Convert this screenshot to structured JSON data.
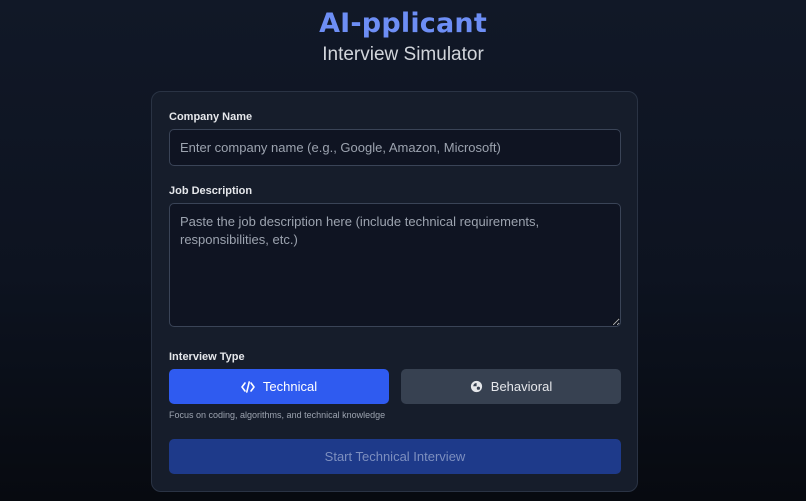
{
  "header": {
    "title": "AI-pplicant",
    "subtitle": "Interview Simulator"
  },
  "form": {
    "company": {
      "label": "Company Name",
      "placeholder": "Enter company name (e.g., Google, Amazon, Microsoft)",
      "value": ""
    },
    "job": {
      "label": "Job Description",
      "placeholder": "Paste the job description here (include technical requirements, responsibilities, etc.)",
      "value": ""
    },
    "interview_type": {
      "label": "Interview Type",
      "options": [
        {
          "label": "Technical",
          "icon": "code-icon",
          "selected": true
        },
        {
          "label": "Behavioral",
          "icon": "chat-icon",
          "selected": false
        }
      ],
      "hint": "Focus on coding, algorithms, and technical knowledge"
    },
    "start_button": "Start Technical Interview"
  },
  "colors": {
    "accent": "#2f5bf0",
    "title": "#6d8ef5",
    "start_button_bg": "#1e3a8a"
  }
}
